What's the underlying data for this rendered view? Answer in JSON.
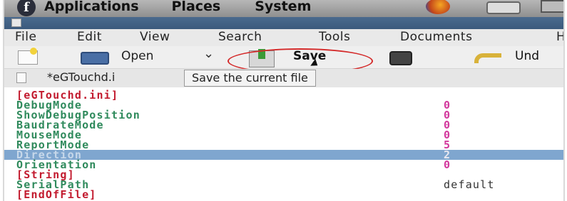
{
  "top_panel": {
    "menus": [
      "Applications",
      "Places",
      "System"
    ],
    "icons": [
      "fedora-logo-icon",
      "firefox-icon",
      "mail-icon",
      "display-icon"
    ]
  },
  "menubar": {
    "items": [
      "File",
      "Edit",
      "View",
      "Search",
      "Tools",
      "Documents",
      "H"
    ]
  },
  "toolbar": {
    "open_label": "Open",
    "save_label": "Save",
    "undo_label": "Und",
    "highlight_color": "#d42a2a"
  },
  "tab": {
    "label": "*eGTouchd.i"
  },
  "tooltip": {
    "text": "Save the current file"
  },
  "editor": {
    "lines": [
      {
        "key": "[eGTouchd.ini]",
        "value": ""
      },
      {
        "key": "DebugMode",
        "value": "0"
      },
      {
        "key": "ShowDebugPosition",
        "value": "0"
      },
      {
        "key": "BaudrateMode",
        "value": "0"
      },
      {
        "key": "MouseMode",
        "value": "0"
      },
      {
        "key": "ReportMode",
        "value": "5"
      },
      {
        "key": "Direction",
        "value": "2"
      },
      {
        "key": "Orientation",
        "value": "0"
      },
      {
        "key": "[String]",
        "value": ""
      },
      {
        "key": "SerialPath",
        "value": "default"
      },
      {
        "key": "[EndOfFile]",
        "value": ""
      }
    ],
    "selected_line_key": "Direction",
    "colors": {
      "section": "#c21a2e",
      "key": "#2f8a5c",
      "value": "#d2379c",
      "selection": "#7fa6cf"
    }
  }
}
